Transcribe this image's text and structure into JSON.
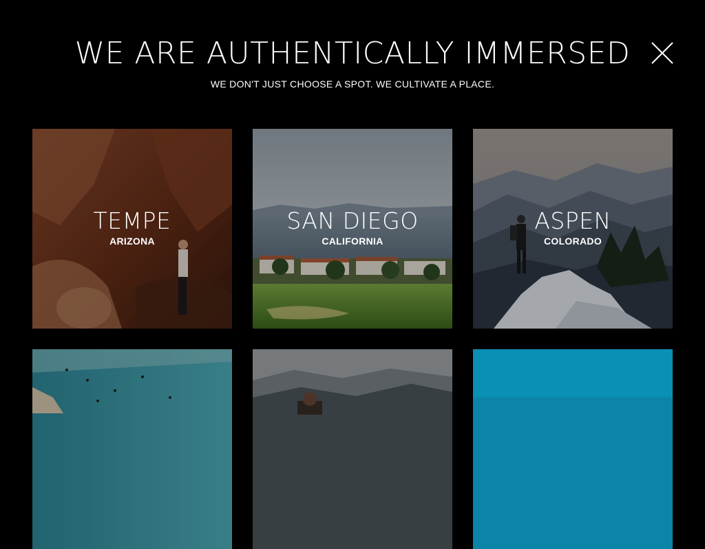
{
  "header": {
    "headline": "WE ARE AUTHENTICALLY IMMERSED",
    "subline": "WE DON'T JUST CHOOSE A SPOT. WE CULTIVATE A PLACE."
  },
  "close_icon": "close-icon",
  "destinations": [
    {
      "city": "TEMPE",
      "state": "ARIZONA"
    },
    {
      "city": "SAN DIEGO",
      "state": "CALIFORNIA"
    },
    {
      "city": "ASPEN",
      "state": "COLORADO"
    },
    {
      "city": "",
      "state": ""
    },
    {
      "city": "",
      "state": ""
    },
    {
      "city": "",
      "state": ""
    }
  ],
  "colors": {
    "background": "#000000",
    "text": "#ffffff",
    "teal_tile": "#0a8fb5"
  }
}
